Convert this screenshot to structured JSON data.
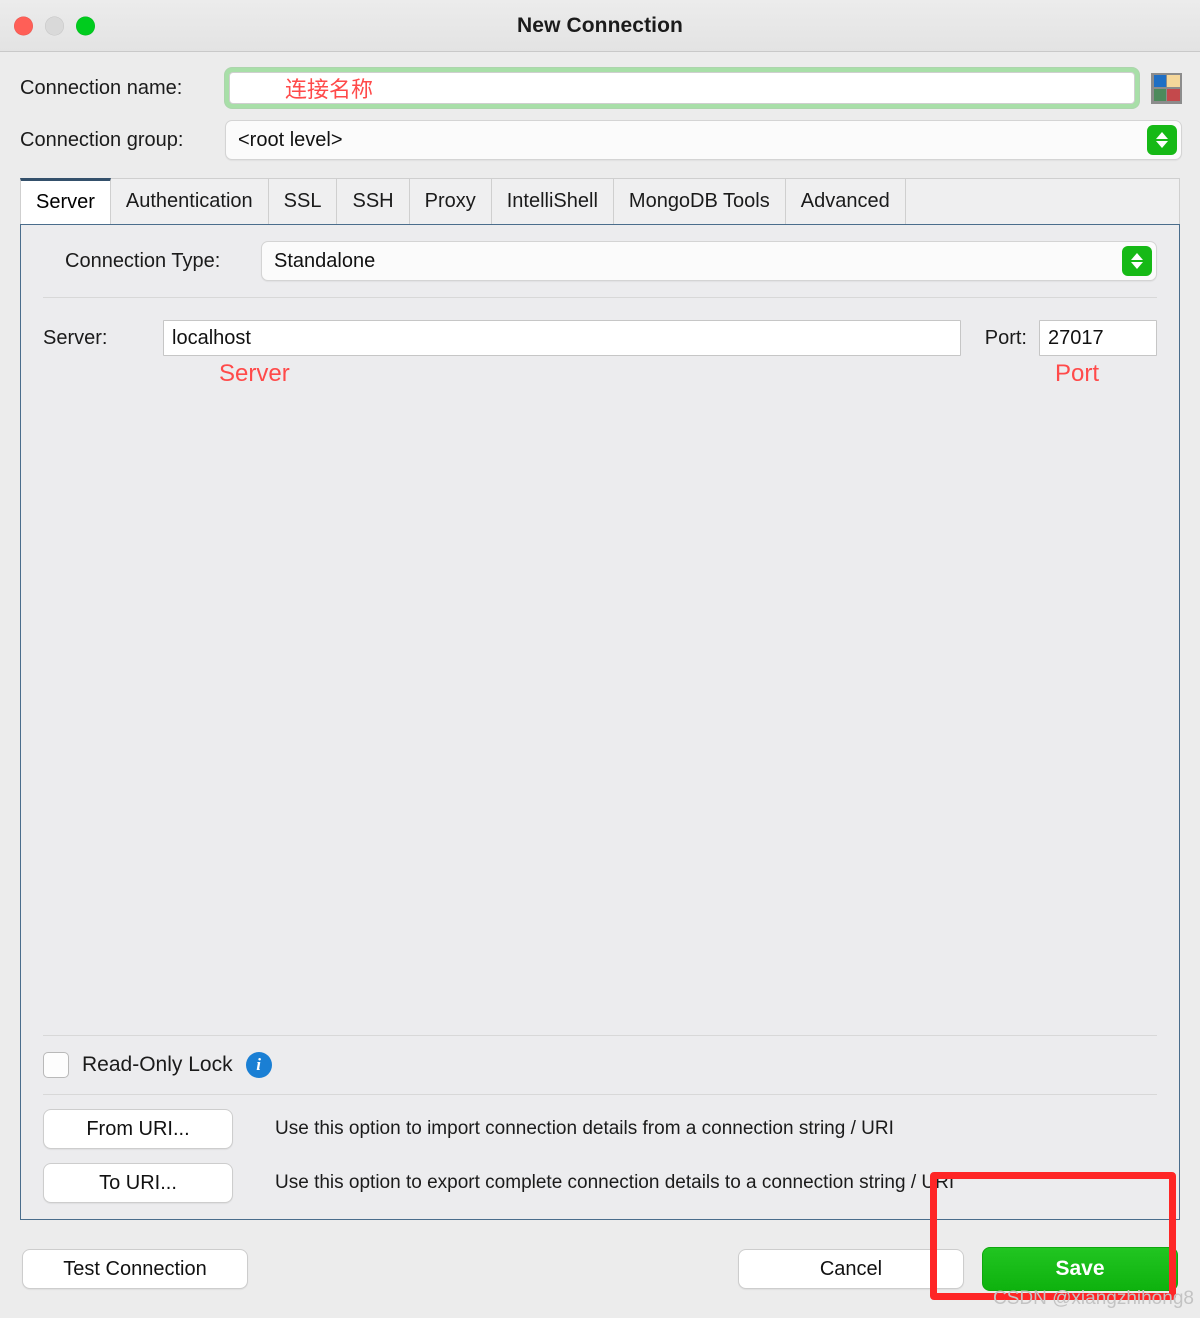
{
  "window": {
    "title": "New Connection",
    "traffic_lights": [
      "close",
      "minimize",
      "zoom"
    ]
  },
  "top_form": {
    "connection_name": {
      "label": "Connection name:",
      "value": "",
      "placeholder": "",
      "annotation": "连接名称",
      "annotation_color": "#ff4a4a",
      "focus_ring_color": "#a8dfa8"
    },
    "color_swatch": {
      "name": "color-swatch",
      "colors": [
        "#1f6fc4",
        "#f5d79a",
        "#4d8a5c",
        "#c4494c"
      ]
    },
    "connection_group": {
      "label": "Connection group:",
      "value": "<root level>"
    }
  },
  "tabs": [
    {
      "label": "Server",
      "active": true
    },
    {
      "label": "Authentication",
      "active": false
    },
    {
      "label": "SSL",
      "active": false
    },
    {
      "label": "SSH",
      "active": false
    },
    {
      "label": "Proxy",
      "active": false
    },
    {
      "label": "IntelliShell",
      "active": false
    },
    {
      "label": "MongoDB Tools",
      "active": false
    },
    {
      "label": "Advanced",
      "active": false
    }
  ],
  "server_tab": {
    "connection_type": {
      "label": "Connection Type:",
      "value": "Standalone"
    },
    "server": {
      "label": "Server:",
      "value": "localhost",
      "annotation": "Server"
    },
    "port": {
      "label": "Port:",
      "value": "27017",
      "annotation": "Port"
    },
    "read_only_lock": {
      "label": "Read-Only Lock",
      "checked": false,
      "info_glyph": "i"
    },
    "from_uri": {
      "button": "From URI...",
      "description": "Use this option to import connection details from a connection string / URI"
    },
    "to_uri": {
      "button": "To URI...",
      "description": "Use this option to export complete connection details to a connection string / URI"
    }
  },
  "footer": {
    "test_connection": "Test Connection",
    "cancel": "Cancel",
    "save": "Save",
    "save_color": "#16b916"
  },
  "overlays": {
    "highlight_color": "#fe2626",
    "watermark": "CSDN @xiangzhihong8"
  }
}
